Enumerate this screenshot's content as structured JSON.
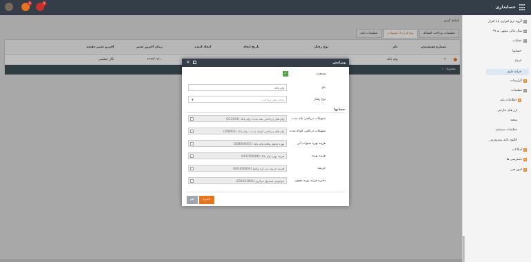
{
  "header": {
    "app_title": "حسابداری",
    "badge_count_1": "1",
    "badge_count_2": "3"
  },
  "sidebar": {
    "items": [
      {
        "label": "گروه نرم افزاری پایا افزار"
      },
      {
        "label": "سال مالی منتهی به ۹۹"
      },
      {
        "label": "عملیات"
      },
      {
        "label": "حسابها"
      },
      {
        "label": "اسناد"
      },
      {
        "label": "خزانه داری"
      },
      {
        "label": "گزارشات"
      },
      {
        "label": "تنظیمات"
      },
      {
        "label": "اطلاعات پایه"
      },
      {
        "label": "ارز های خارجی"
      },
      {
        "label": "شعبه"
      },
      {
        "label": "تنظیمات سیستم"
      },
      {
        "label": "الگوی تائید پیش‌فرض"
      },
      {
        "label": "امکانات"
      },
      {
        "label": "دسترسی ها"
      },
      {
        "label": "امور فنی"
      }
    ]
  },
  "main": {
    "add_link": "اضافه کردن",
    "tabs": [
      "تنظیمات پرداخت اقساط",
      "نوع قرارداد تسهیلات",
      "تنظیمات تائید"
    ],
    "table": {
      "headers": [
        "شماره سیستمی",
        "نام",
        "نوع رفتار",
        "تاریخ ایجاد",
        "ایجاد کننده",
        "زمان آخرین تغییر",
        "آخرین تغییر دهنده"
      ],
      "rows": [
        [
          "۴",
          "وام بانک",
          "",
          "",
          "",
          "۱۳۹۹/۰۷/۱۰",
          "نگار عظیمی"
        ]
      ],
      "summary": "مجموع : ۱"
    }
  },
  "modal": {
    "title": "ویرایش",
    "status_label": "وضعیت",
    "name_label": "نام",
    "name_value": "وام بانک",
    "behavior_label": "نوع رفتار",
    "behavior_placeholder": "بدون پیش پرداخت",
    "accounts_section": "حسابها",
    "fields": [
      {
        "label": "تسهیلات دریافتی بلند مدت",
        "value": "وام های پرداختی بلند مدت- وام بانک (212003)"
      },
      {
        "label": "تسهیلات دریافتی کوتاه مدت",
        "value": "وام های پرداختی کوتاه مدت - وام بانک (208003)"
      },
      {
        "label": "هزینه بهره سنوات آتی",
        "value": "بهره تحقق نیافته وام بانک (208004001)"
      },
      {
        "label": "هزینه بهره",
        "value": "هزینه بهره وام بانک (601006006)"
      },
      {
        "label": "جریمه",
        "value": "هزینه جریمه دیر کرد وامها (601006004)"
      },
      {
        "label": "ذخیره هزینه بهره معوق",
        "value": "موجودی صندوق مرکزی (101001002)"
      }
    ],
    "save_label": "ذخیره",
    "cancel_label": "لغو"
  },
  "colors": {
    "topbar": "#333e48",
    "accent": "#e8731b",
    "check": "#49a641"
  }
}
